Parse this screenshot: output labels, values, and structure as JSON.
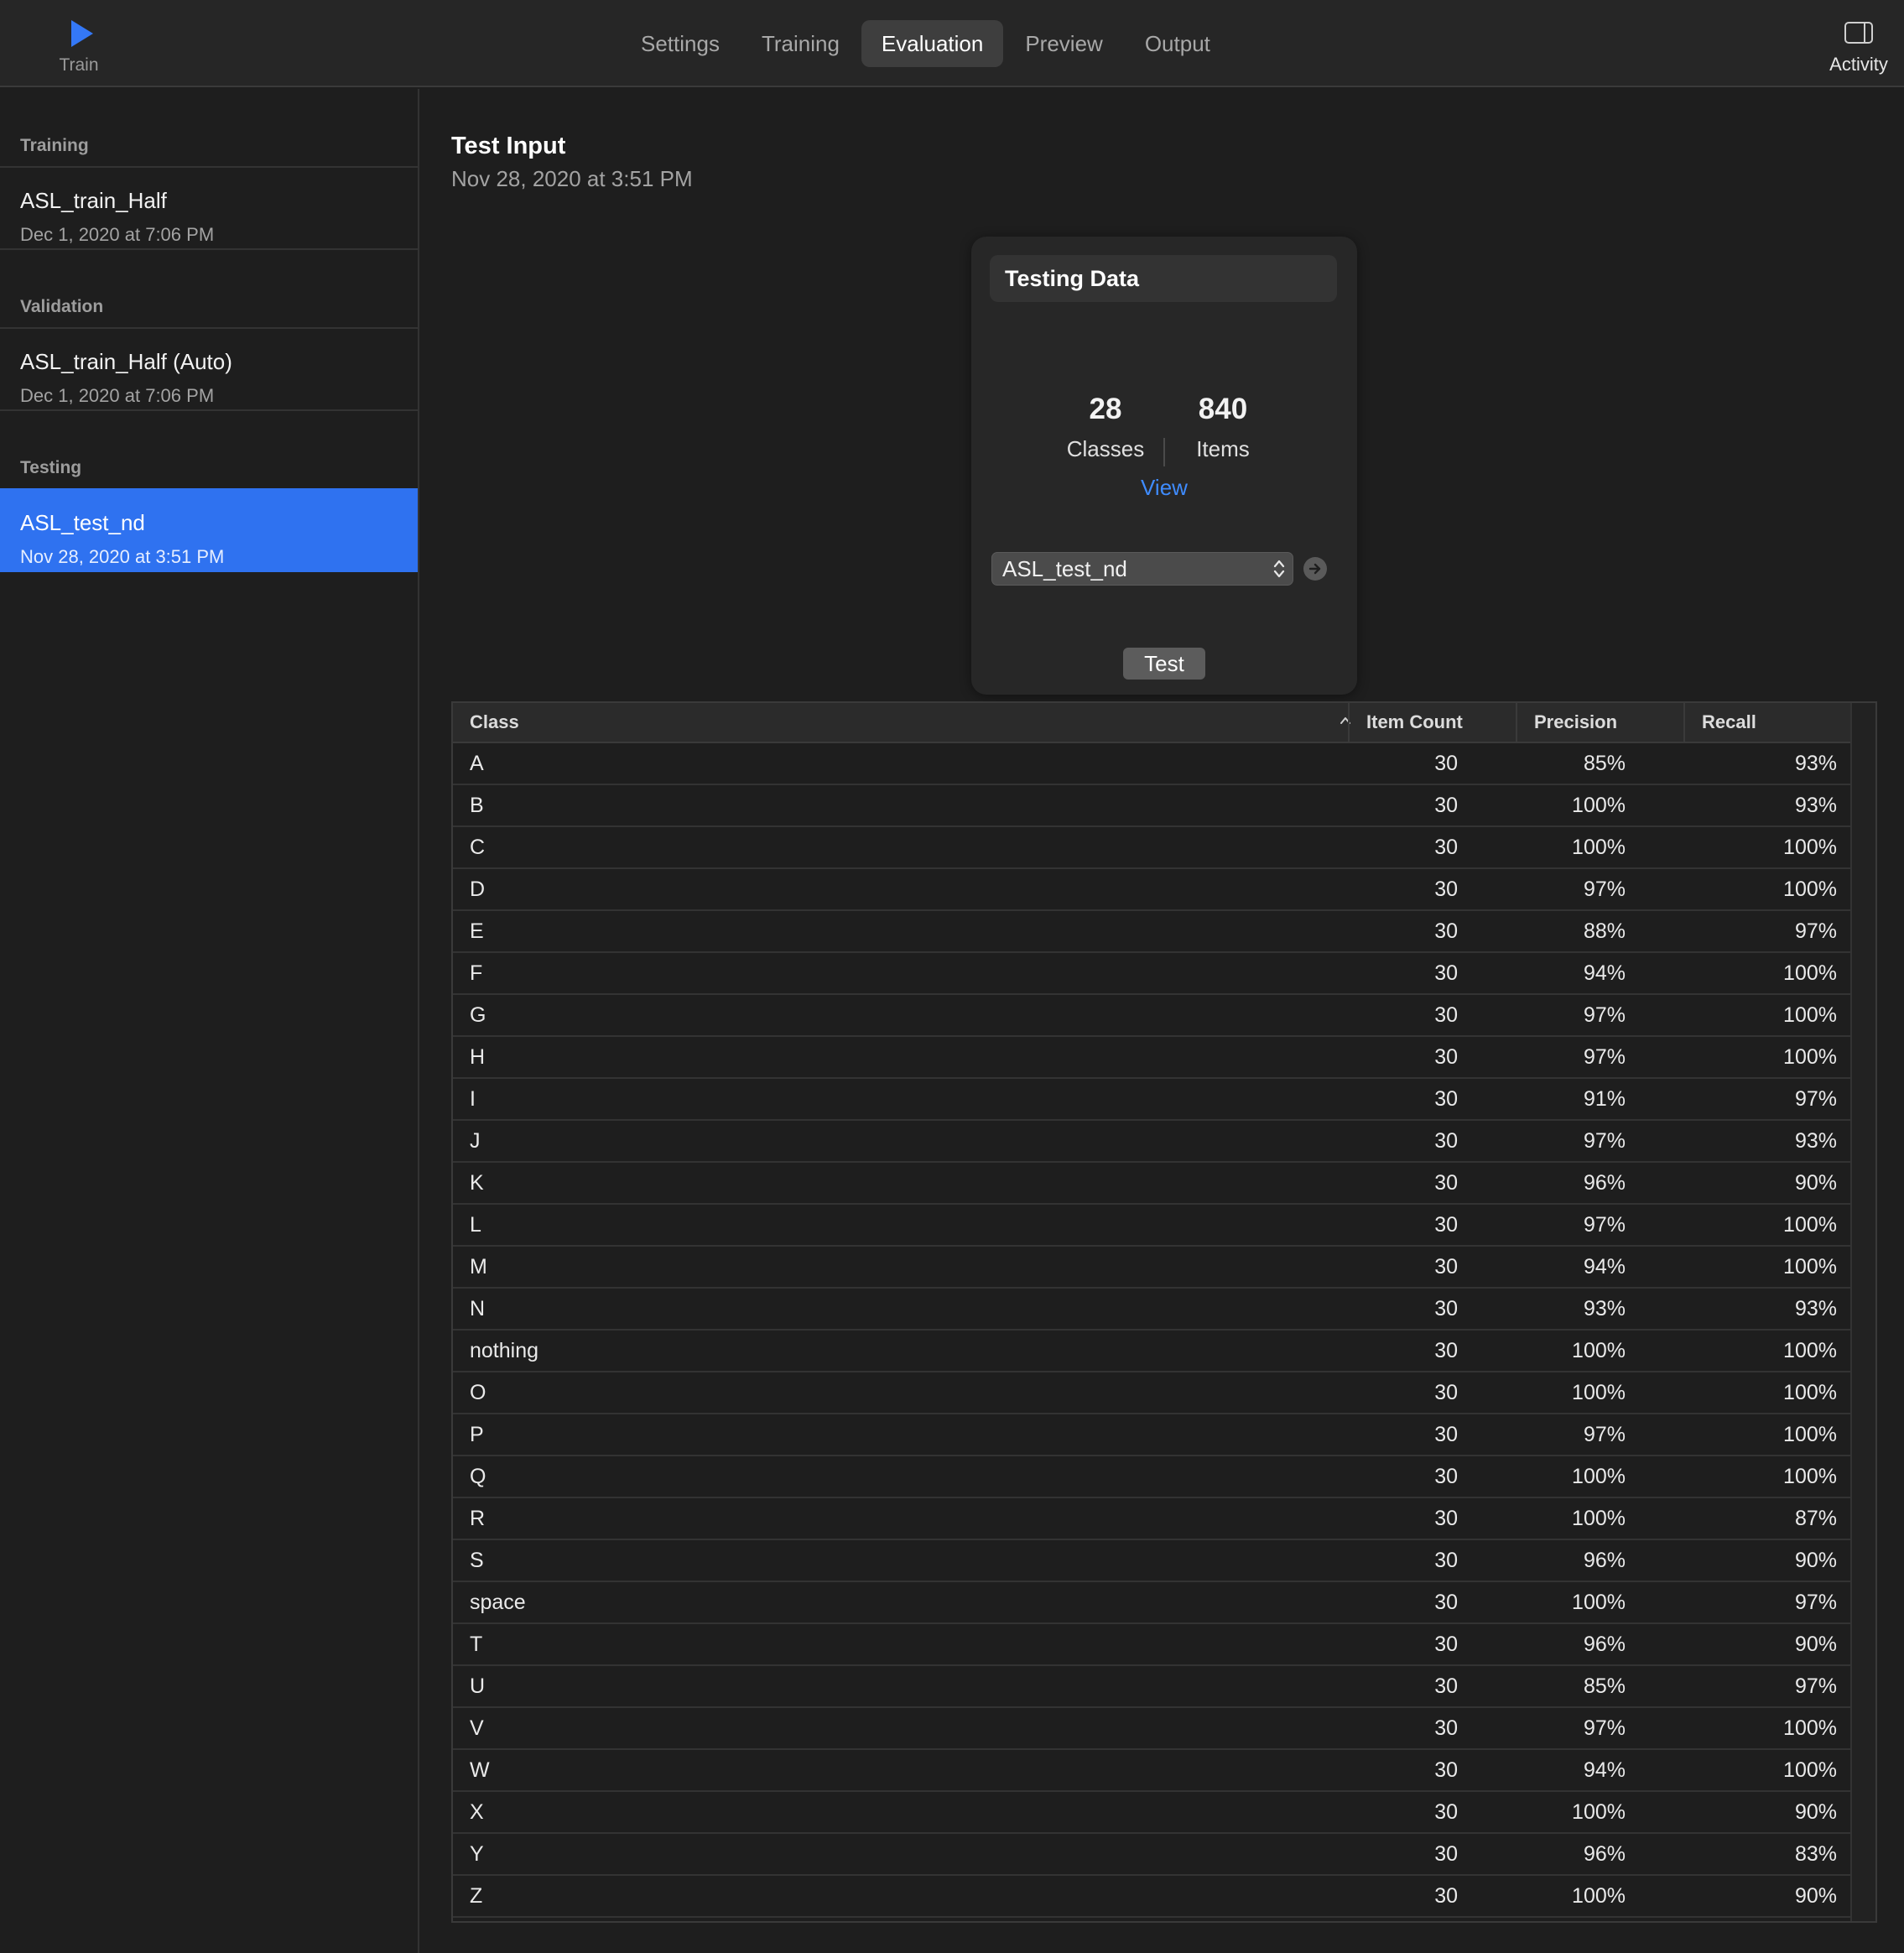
{
  "toolbar": {
    "train_label": "Train",
    "activity_label": "Activity",
    "tabs": [
      "Settings",
      "Training",
      "Evaluation",
      "Preview",
      "Output"
    ],
    "active_tab": "Evaluation",
    "accent_color": "#3478f6"
  },
  "sidebar": {
    "sections": [
      {
        "title": "Training",
        "name": "ASL_train_Half",
        "date": "Dec 1, 2020 at 7:06 PM"
      },
      {
        "title": "Validation",
        "name": "ASL_train_Half (Auto)",
        "date": "Dec 1, 2020 at 7:06 PM"
      },
      {
        "title": "Testing",
        "name": "ASL_test_nd",
        "date": "Nov 28, 2020 at 3:51 PM",
        "selected": true
      }
    ],
    "selection_color": "#2f72f0"
  },
  "main": {
    "title": "Test Input",
    "subtitle": "Nov 28, 2020 at 3:51 PM",
    "card": {
      "title": "Testing Data",
      "classes_count": "28",
      "classes_label": "Classes",
      "items_count": "840",
      "items_label": "Items",
      "view_label": "View",
      "dataset_value": "ASL_test_nd"
    },
    "test_button": "Test"
  },
  "table": {
    "headers": [
      "Class",
      "Item Count",
      "Precision",
      "Recall"
    ],
    "sorted_by": "Class",
    "rows": [
      [
        "A",
        "30",
        "85%",
        "93%"
      ],
      [
        "B",
        "30",
        "100%",
        "93%"
      ],
      [
        "C",
        "30",
        "100%",
        "100%"
      ],
      [
        "D",
        "30",
        "97%",
        "100%"
      ],
      [
        "E",
        "30",
        "88%",
        "97%"
      ],
      [
        "F",
        "30",
        "94%",
        "100%"
      ],
      [
        "G",
        "30",
        "97%",
        "100%"
      ],
      [
        "H",
        "30",
        "97%",
        "100%"
      ],
      [
        "I",
        "30",
        "91%",
        "97%"
      ],
      [
        "J",
        "30",
        "97%",
        "93%"
      ],
      [
        "K",
        "30",
        "96%",
        "90%"
      ],
      [
        "L",
        "30",
        "97%",
        "100%"
      ],
      [
        "M",
        "30",
        "94%",
        "100%"
      ],
      [
        "N",
        "30",
        "93%",
        "93%"
      ],
      [
        "nothing",
        "30",
        "100%",
        "100%"
      ],
      [
        "O",
        "30",
        "100%",
        "100%"
      ],
      [
        "P",
        "30",
        "97%",
        "100%"
      ],
      [
        "Q",
        "30",
        "100%",
        "100%"
      ],
      [
        "R",
        "30",
        "100%",
        "87%"
      ],
      [
        "S",
        "30",
        "96%",
        "90%"
      ],
      [
        "space",
        "30",
        "100%",
        "97%"
      ],
      [
        "T",
        "30",
        "96%",
        "90%"
      ],
      [
        "U",
        "30",
        "85%",
        "97%"
      ],
      [
        "V",
        "30",
        "97%",
        "100%"
      ],
      [
        "W",
        "30",
        "94%",
        "100%"
      ],
      [
        "X",
        "30",
        "100%",
        "90%"
      ],
      [
        "Y",
        "30",
        "96%",
        "83%"
      ],
      [
        "Z",
        "30",
        "100%",
        "90%"
      ]
    ]
  }
}
